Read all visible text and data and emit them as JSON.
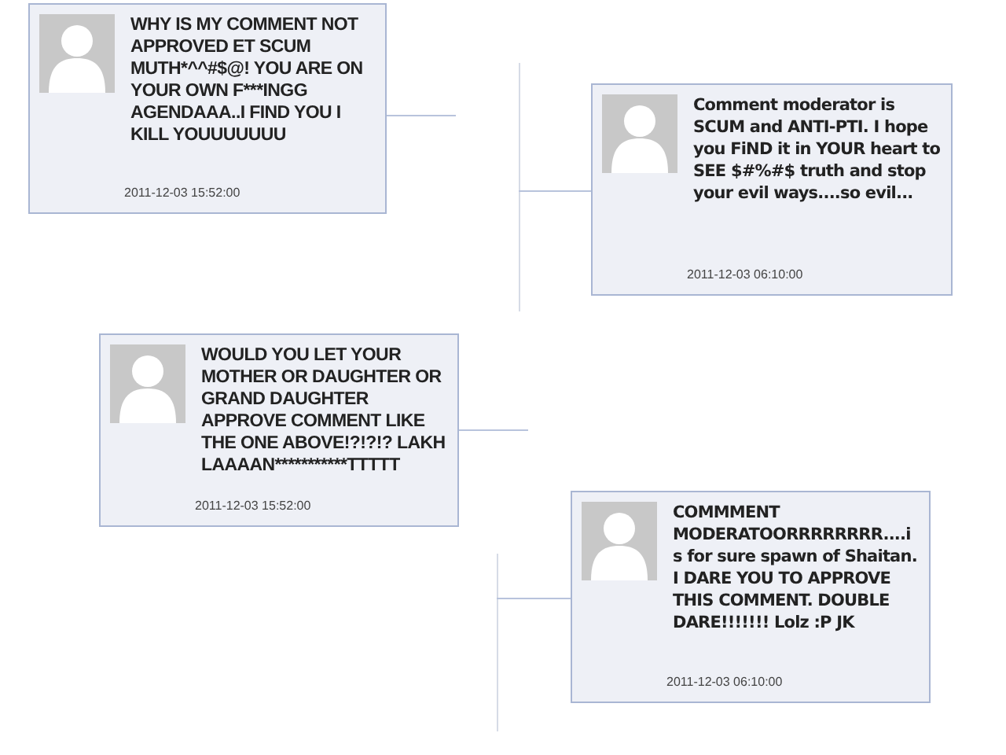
{
  "comments": [
    {
      "text": "WHY IS MY COMMENT NOT APPROVED ET SCUM MUTH*^^#$@! YOU ARE ON YOUR OWN F***INGG AGENDAAA..I FIND YOU I KILL YOUUUUUUU",
      "date": "2011-12-03 15:52:00"
    },
    {
      "text": "Comment moderator is SCUM and ANTI-PTI. I hope you FiND it in YOUR heart to SEE $#%#$ truth and stop your evil ways....so evil...",
      "date": "2011-12-03 06:10:00"
    },
    {
      "text": "WOULD YOU LET YOUR MOTHER OR DAUGHTER OR GRAND DAUGHTER APPROVE COMMENT LIKE THE ONE ABOVE!?!?!? LAKH LAAAAN***********TTTTT",
      "date": "2011-12-03 15:52:00"
    },
    {
      "text": "COMMMENT MODERATOORRRRRRRR....is for sure spawn of Shaitan. I DARE YOU TO APPROVE THIS COMMENT. DOUBLE DARE!!!!!!! Lolz :P JK",
      "date": "2011-12-03 06:10:00"
    }
  ]
}
